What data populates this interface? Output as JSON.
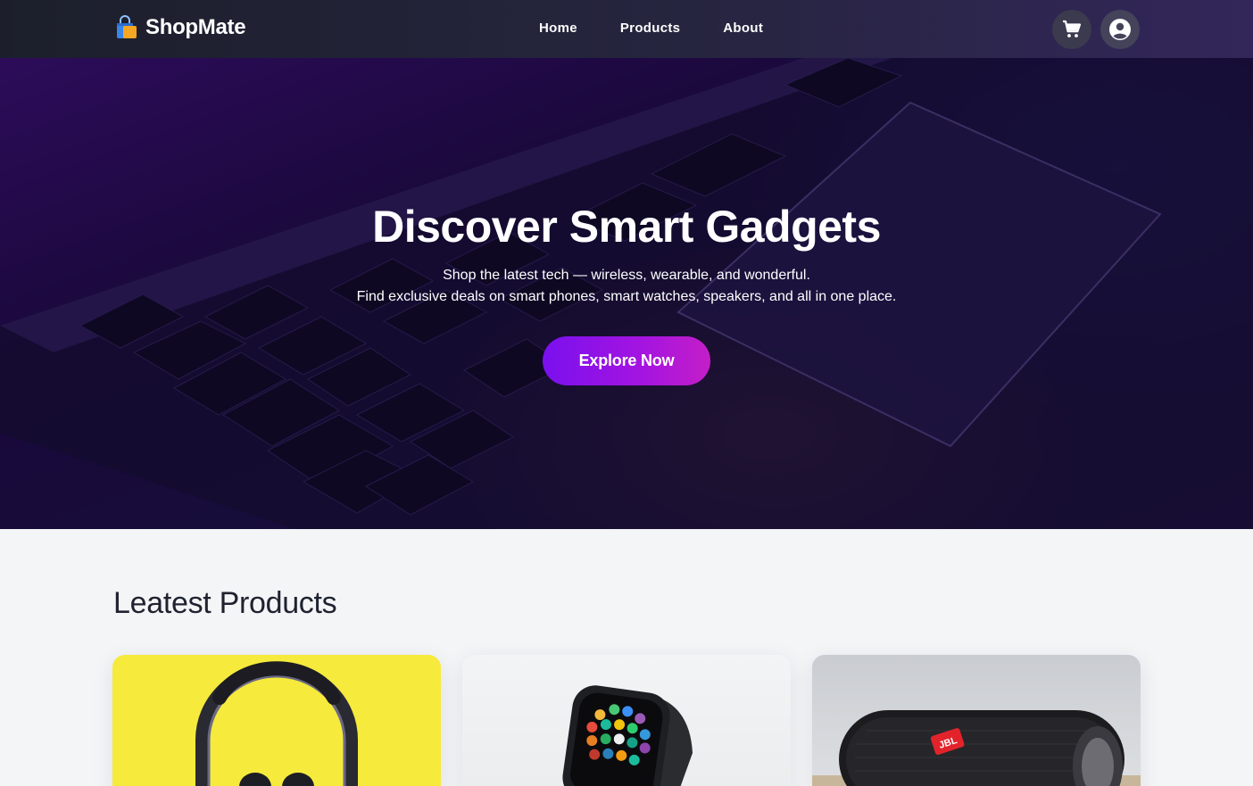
{
  "navbar": {
    "brand": "ShopMate",
    "brand_icon": "shopping-bag-icon",
    "links": [
      "Home",
      "Products",
      "About"
    ],
    "cart_icon": "cart-icon",
    "account_icon": "user-circle-icon"
  },
  "hero": {
    "title": "Discover Smart Gadgets",
    "subtitle_line1": "Shop the latest tech — wireless, wearable, and wonderful.",
    "subtitle_line2": "Find exclusive deals on smart phones, smart watches, speakers, and all in one place.",
    "cta": "Explore Now"
  },
  "products_section": {
    "title": "Leatest Products",
    "cards": [
      {
        "image": "headphones-image",
        "background": "#f6ea3c"
      },
      {
        "image": "smartwatch-image",
        "background": "#eeeff0"
      },
      {
        "image": "speaker-image",
        "background": "#d4d6da",
        "logo_text": "JBL"
      }
    ]
  },
  "colors": {
    "nav_bg": "#1c1f2b",
    "accent": "#8a12ea",
    "text_dark": "#1f2330",
    "page_bg": "#f4f5f7"
  }
}
